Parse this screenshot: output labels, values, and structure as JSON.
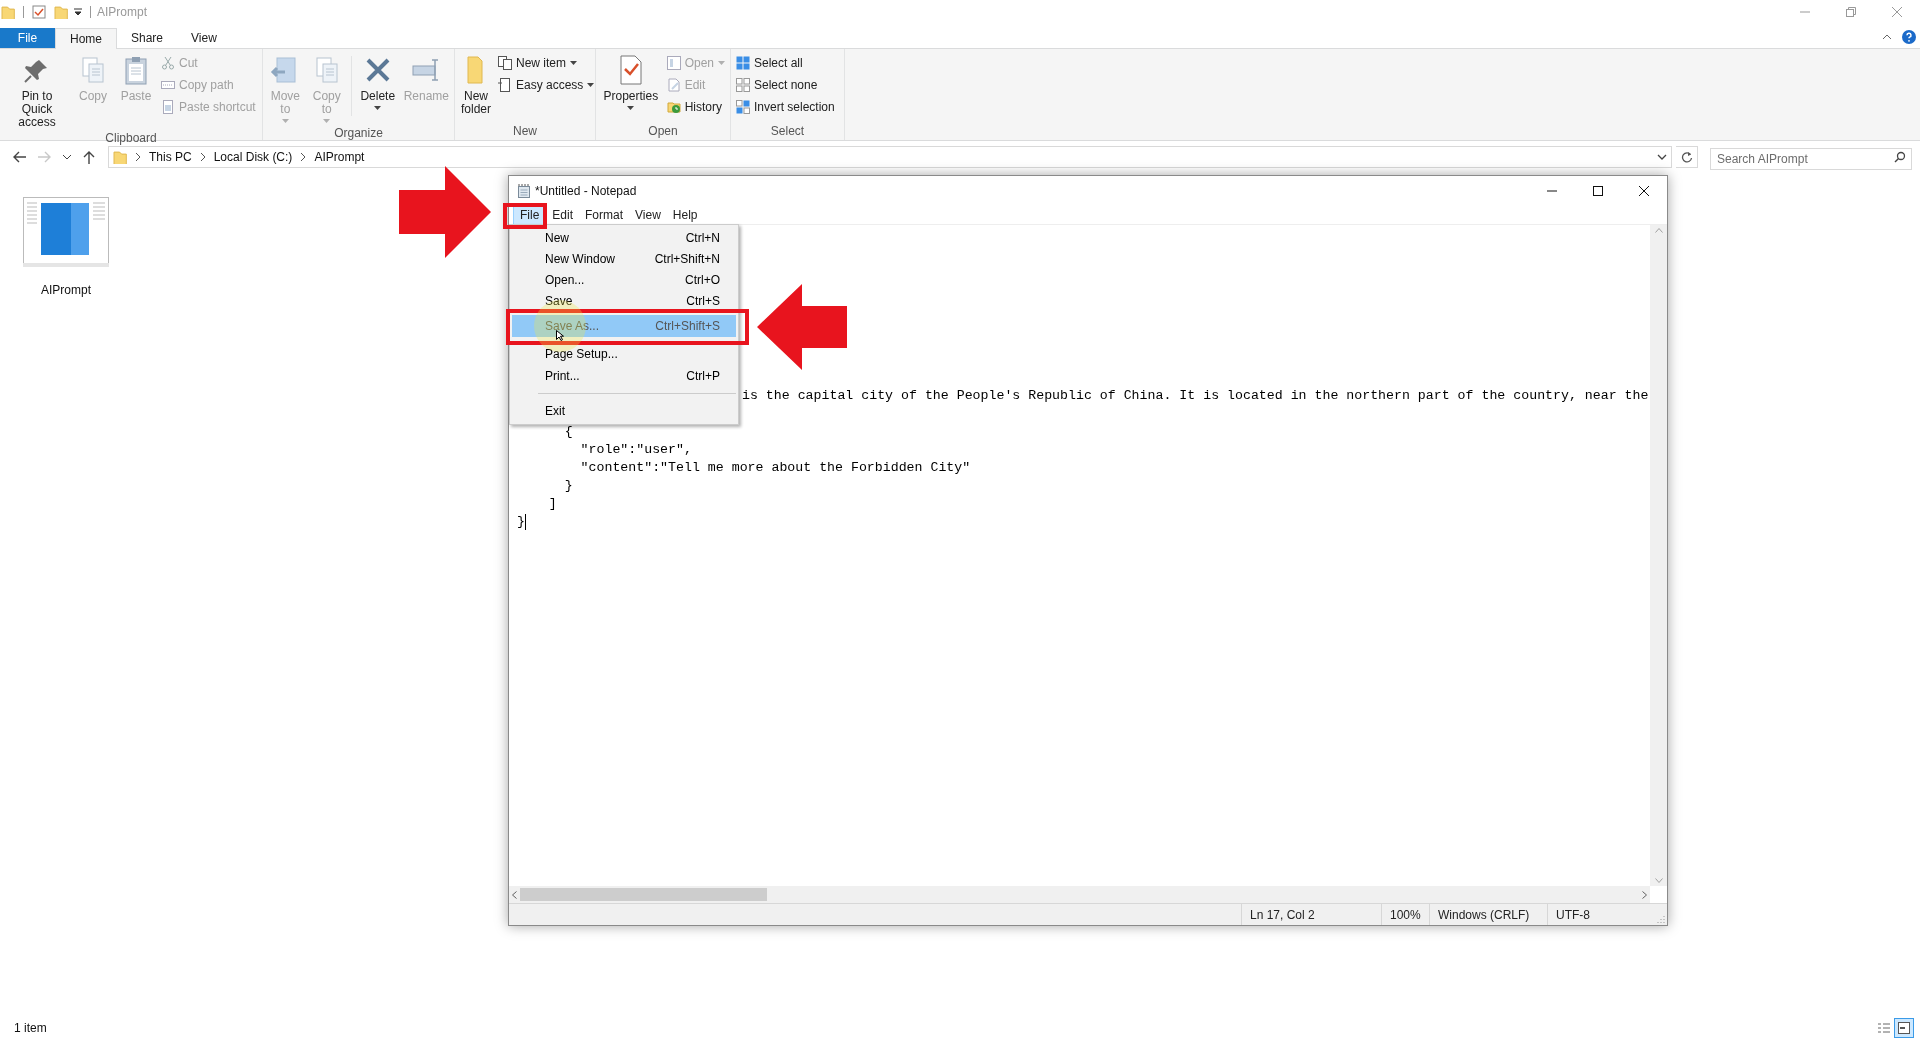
{
  "window": {
    "title": "AIPrompt"
  },
  "ribbon": {
    "tabs": [
      {
        "label": "File",
        "kind": "file",
        "selected": false
      },
      {
        "label": "Home",
        "kind": "tab",
        "selected": true
      },
      {
        "label": "Share",
        "kind": "tab",
        "selected": false
      },
      {
        "label": "View",
        "kind": "tab",
        "selected": false
      }
    ],
    "groups": [
      {
        "label": "Clipboard",
        "buttons": [
          {
            "kind": "large",
            "label": "Pin to Quick access",
            "disabled": false,
            "dropdown": false
          },
          {
            "kind": "large",
            "label": "Copy",
            "disabled": true,
            "dropdown": false
          },
          {
            "kind": "large",
            "label": "Paste",
            "disabled": true,
            "dropdown": false
          },
          {
            "kind": "small",
            "label": "Cut",
            "disabled": true,
            "dropdown": false
          },
          {
            "kind": "small",
            "label": "Copy path",
            "disabled": true,
            "dropdown": false
          },
          {
            "kind": "small",
            "label": "Paste shortcut",
            "disabled": true,
            "dropdown": false
          }
        ]
      },
      {
        "label": "Organize",
        "buttons": [
          {
            "kind": "large",
            "label": "Move to",
            "disabled": true,
            "dropdown": true
          },
          {
            "kind": "large",
            "label": "Copy to",
            "disabled": true,
            "dropdown": true
          },
          {
            "kind": "large",
            "label": "Delete",
            "disabled": false,
            "dropdown": true
          },
          {
            "kind": "large",
            "label": "Rename",
            "disabled": true,
            "dropdown": false
          }
        ]
      },
      {
        "label": "New",
        "buttons": [
          {
            "kind": "large",
            "label": "New folder",
            "disabled": false,
            "dropdown": false
          },
          {
            "kind": "small",
            "label": "New item",
            "disabled": false,
            "dropdown": true
          },
          {
            "kind": "small",
            "label": "Easy access",
            "disabled": false,
            "dropdown": true
          }
        ]
      },
      {
        "label": "Open",
        "buttons": [
          {
            "kind": "large",
            "label": "Properties",
            "disabled": false,
            "dropdown": true
          },
          {
            "kind": "small",
            "label": "Open",
            "disabled": true,
            "dropdown": true
          },
          {
            "kind": "small",
            "label": "Edit",
            "disabled": true,
            "dropdown": false
          },
          {
            "kind": "small",
            "label": "History",
            "disabled": false,
            "dropdown": false
          }
        ]
      },
      {
        "label": "Select",
        "buttons": [
          {
            "kind": "small",
            "label": "Select all",
            "disabled": false,
            "dropdown": false
          },
          {
            "kind": "small",
            "label": "Select none",
            "disabled": false,
            "dropdown": false
          },
          {
            "kind": "small",
            "label": "Invert selection",
            "disabled": false,
            "dropdown": false
          }
        ]
      }
    ]
  },
  "nav_buttons": [
    {
      "kind": "back",
      "disabled": false
    },
    {
      "kind": "forward",
      "disabled": true
    },
    {
      "kind": "recent",
      "disabled": false
    },
    {
      "kind": "up",
      "disabled": false
    }
  ],
  "breadcrumb": [
    "This PC",
    "Local Disk (C:)",
    "AIPrompt"
  ],
  "search": {
    "placeholder": "Search AIPrompt"
  },
  "files": [
    {
      "name": "AIPrompt"
    }
  ],
  "status_bar": {
    "count": "1 item",
    "view_buttons": [
      {
        "selected": false
      },
      {
        "selected": true
      }
    ]
  },
  "notepad": {
    "title": "*Untitled - Notepad",
    "menu": [
      {
        "label": "File",
        "selected": true
      },
      {
        "label": "Edit",
        "selected": false
      },
      {
        "label": "Format",
        "selected": false
      },
      {
        "label": "View",
        "selected": false
      },
      {
        "label": "Help",
        "selected": false
      }
    ],
    "file_menu": [
      {
        "kind": "item",
        "label": "New",
        "shortcut": "Ctrl+N",
        "selected": false
      },
      {
        "kind": "item",
        "label": "New Window",
        "shortcut": "Ctrl+Shift+N",
        "selected": false
      },
      {
        "kind": "item",
        "label": "Open...",
        "shortcut": "Ctrl+O",
        "selected": false
      },
      {
        "kind": "item",
        "label": "Save",
        "shortcut": "Ctrl+S",
        "selected": false
      },
      {
        "kind": "item",
        "label": "Save As...",
        "shortcut": "Ctrl+Shift+S",
        "selected": true
      },
      {
        "kind": "item",
        "label": "Page Setup...",
        "selected": false
      },
      {
        "kind": "item",
        "label": "Print...",
        "shortcut": "Ctrl+P",
        "selected": false
      },
      {
        "kind": "separator"
      },
      {
        "kind": "item",
        "label": "Exit",
        "selected": false
      }
    ],
    "text_lines": [
      {
        "kind": "covered",
        "text": "is the capital city of the People's Republic of China. It is located in the northern part of the country, near the"
      },
      {
        "kind": "plain",
        "text": "      {"
      },
      {
        "kind": "plain",
        "text": "        \"role\":\"user\","
      },
      {
        "kind": "plain",
        "text": "        \"content\":\"Tell me more about the Forbidden City\""
      },
      {
        "kind": "plain",
        "text": "      }"
      },
      {
        "kind": "plain",
        "text": "    ]"
      },
      {
        "kind": "plain",
        "text": "}"
      }
    ],
    "status_bar": {
      "position": "Ln 17, Col 2",
      "zoom": "100%",
      "line_ending": "Windows (CRLF)",
      "encoding": "UTF-8"
    }
  }
}
